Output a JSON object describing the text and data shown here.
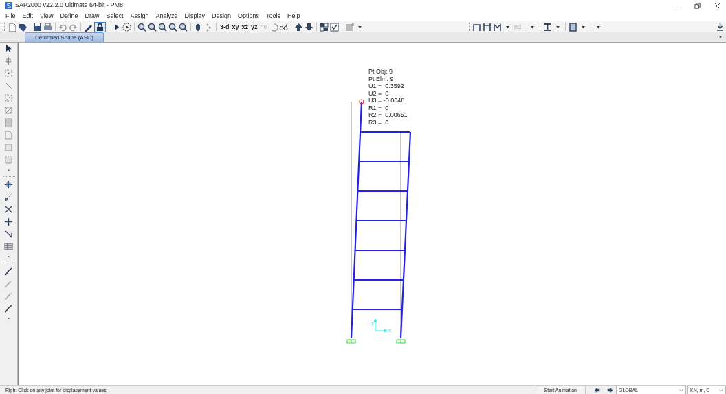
{
  "window": {
    "title": "SAP2000 v22.2.0 Ultimate 64-bit - PM8"
  },
  "menu": [
    "File",
    "Edit",
    "View",
    "Define",
    "Draw",
    "Select",
    "Assign",
    "Analyze",
    "Display",
    "Design",
    "Options",
    "Tools",
    "Help"
  ],
  "toolbar": {
    "view_buttons": [
      {
        "label": "3-d",
        "disabled": false
      },
      {
        "label": "xy",
        "disabled": false
      },
      {
        "label": "xz",
        "disabled": false
      },
      {
        "label": "yz",
        "disabled": false
      },
      {
        "label": "nv",
        "disabled": true
      }
    ],
    "node_button": {
      "label": "nd",
      "disabled": true
    }
  },
  "tabs": [
    {
      "label": "Deformed Shape (ASO)",
      "selected": true
    }
  ],
  "point_info": {
    "lines": [
      "Pt Obj: 9",
      "Pt Elm: 9",
      "U1 =  0.3592",
      "U2 =  0",
      "U3 = -0.0048",
      "R1 =  0",
      "R2 =  0.00651",
      "R3 =  0"
    ]
  },
  "axes": {
    "vertical_label": "z",
    "horizontal_label": "x"
  },
  "status_bar": {
    "message": "Right Click on any joint for displacement values",
    "animation_button": "Start Animation",
    "coordinate_system": "GLOBAL",
    "units": "KN, m, C"
  }
}
